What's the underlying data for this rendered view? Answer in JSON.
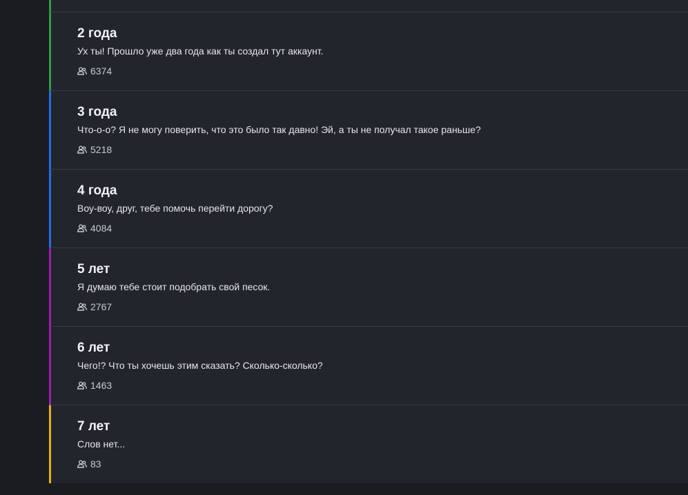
{
  "colors": {
    "background": "#1b1c20",
    "card": "#23252d",
    "divider": "#393b44",
    "green": "#2ea043",
    "blue": "#1f6feb",
    "purple": "#a21caf",
    "yellow": "#eab308"
  },
  "items": [
    {
      "title": "2 года",
      "description": "Ух ты! Прошло уже два года как ты создал тут аккаунт.",
      "count": "6374",
      "icon": "users-icon",
      "accent": "green"
    },
    {
      "title": "3 года",
      "description": "Что-о-о? Я не могу поверить, что это было так давно! Эй, а ты не получал такое раньше?",
      "count": "5218",
      "icon": "users-icon",
      "accent": "blue"
    },
    {
      "title": "4 года",
      "description": "Воу-воу, друг, тебе помочь перейти дорогу?",
      "count": "4084",
      "icon": "users-icon",
      "accent": "blue"
    },
    {
      "title": "5 лет",
      "description": "Я думаю тебе стоит подобрать свой песок.",
      "count": "2767",
      "icon": "users-icon",
      "accent": "purple"
    },
    {
      "title": "6 лет",
      "description": "Чего!? Что ты хочешь этим сказать? Сколько-сколько?",
      "count": "1463",
      "icon": "users-icon",
      "accent": "purple"
    },
    {
      "title": "7 лет",
      "description": "Слов нет...",
      "count": "83",
      "icon": "users-icon",
      "accent": "yellow"
    }
  ]
}
